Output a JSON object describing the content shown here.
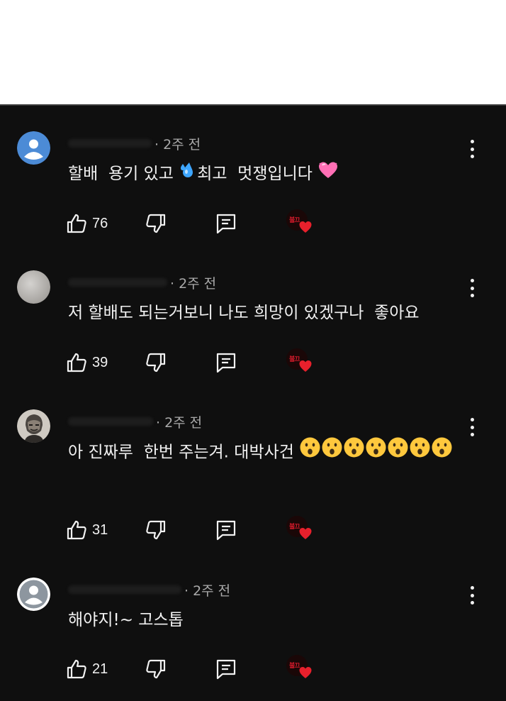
{
  "comments": [
    {
      "meta": "· 2주 전",
      "text_parts": [
        "할배  용기 있고 ",
        "최고  멋쟁입니다 "
      ],
      "likes": "76",
      "avatar": "default-avatar-blue"
    },
    {
      "meta": "· 2주 전",
      "text_parts": [
        "저 할배도 되는거보니 나도 희망이 있겠구나  좋아요"
      ],
      "likes": "39",
      "avatar": "photo-avatar-gray"
    },
    {
      "meta": "· 2주 전",
      "text_parts": [
        "아 진짜루  한번 주는겨. 대박사건 "
      ],
      "likes": "31",
      "avatar": "illustrated-avatar"
    },
    {
      "meta": "· 2주 전",
      "text_parts": [
        "해야지!~ 고스톱"
      ],
      "likes": "21",
      "avatar": "default-avatar-gray"
    }
  ],
  "creator_heart": {
    "badge_text": "불끄",
    "heart_color": "#e8202c"
  },
  "colors": {
    "background": "#0f0f0f",
    "text": "#f1f1f1",
    "meta": "#aaaaaa"
  },
  "icons": [
    "thumbs-up-icon",
    "thumbs-down-icon",
    "reply-icon",
    "more-vert-icon",
    "heart-icon",
    "sweat-droplets-icon",
    "pink-heart-icon",
    "surprised-face-icon"
  ]
}
